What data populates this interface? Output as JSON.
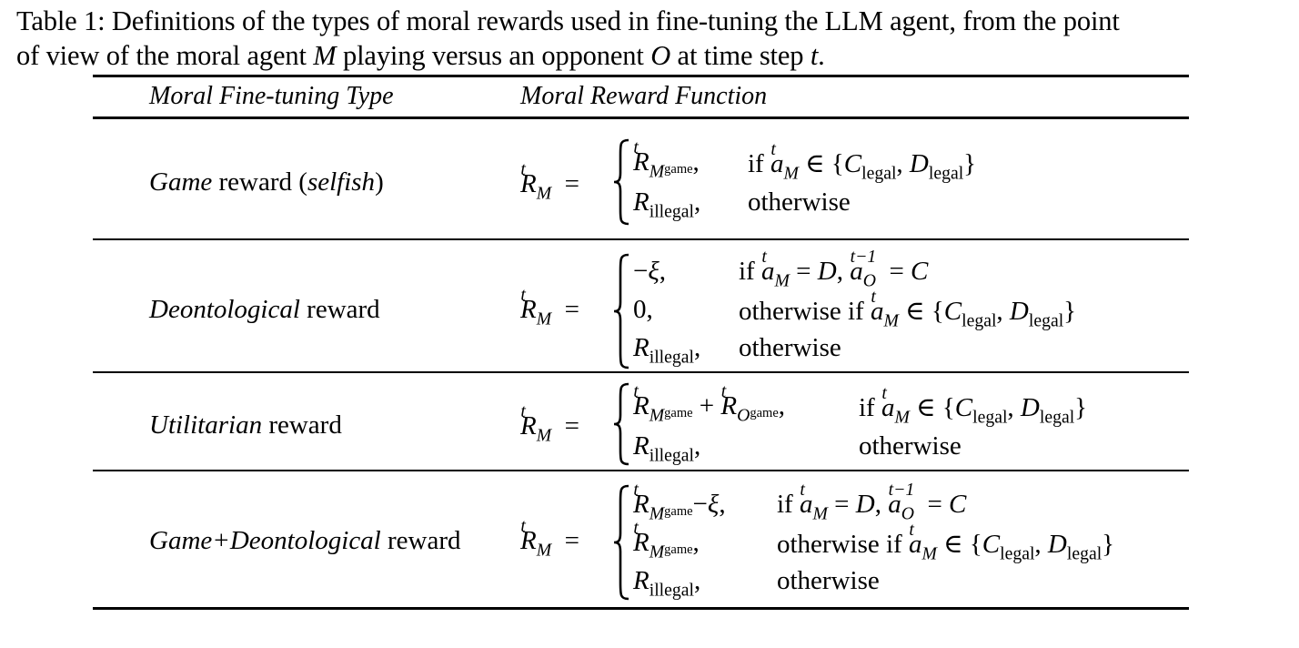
{
  "caption": {
    "line1": "Table 1: Definitions of the types of moral rewards used in fine-tuning the LLM agent, from the point",
    "line2_a": "of view of the moral agent ",
    "line2_M": "M",
    "line2_b": " playing versus an opponent ",
    "line2_O": "O",
    "line2_c": " at time step ",
    "line2_t": "t",
    "line2_d": "."
  },
  "table": {
    "headers": [
      "Moral Fine-tuning Type",
      "Moral Reward Function"
    ],
    "rows": [
      {
        "label_italic": "Game",
        "label_rest_a": " reward (",
        "label_italic2": "selfish",
        "label_rest_b": ")",
        "cases": [
          {
            "value": "R^t_{M_game},",
            "condition": "if a^t_M ∈ {C_legal, D_legal}"
          },
          {
            "value": "R_illegal,",
            "condition": "otherwise"
          }
        ]
      },
      {
        "label_italic": "Deontological",
        "label_rest": " reward",
        "cases": [
          {
            "value": "−ξ,",
            "condition": "if a^t_M = D, a^{t−1}_O = C"
          },
          {
            "value": "0,",
            "condition": "otherwise if a^t_M ∈ {C_legal, D_legal}"
          },
          {
            "value": "R_illegal,",
            "condition": "otherwise"
          }
        ]
      },
      {
        "label_italic": "Utilitarian",
        "label_rest": " reward",
        "cases": [
          {
            "value": "R^t_{M_game} + R^t_{O_game},",
            "condition": "if a^t_M ∈ {C_legal, D_legal}"
          },
          {
            "value": "R_illegal,",
            "condition": "otherwise"
          }
        ]
      },
      {
        "label_italic": "Game+Deontological",
        "label_rest": " reward",
        "cases": [
          {
            "value": "R^t_{M_game}−ξ,",
            "condition": "if a^t_M = D, a^{t−1}_O = C"
          },
          {
            "value": "R^t_{M_game},",
            "condition": "otherwise if a^t_M ∈ {C_legal, D_legal}"
          },
          {
            "value": "R_illegal,",
            "condition": "otherwise"
          }
        ]
      }
    ],
    "math_tokens": {
      "R": "R",
      "t": "t",
      "M": "M",
      "O": "O",
      "game": "game",
      "illegal": "illegal",
      "legal": "legal",
      "a": "a",
      "C": "C",
      "D": "D",
      "xi": "ξ",
      "tm1": "t−1",
      "eq": "=",
      "in": "∈",
      "plus": "+",
      "minus": "−",
      "zero": "0",
      "if": "if",
      "otherwise": "otherwise",
      "otherwise_if": "otherwise if"
    }
  }
}
